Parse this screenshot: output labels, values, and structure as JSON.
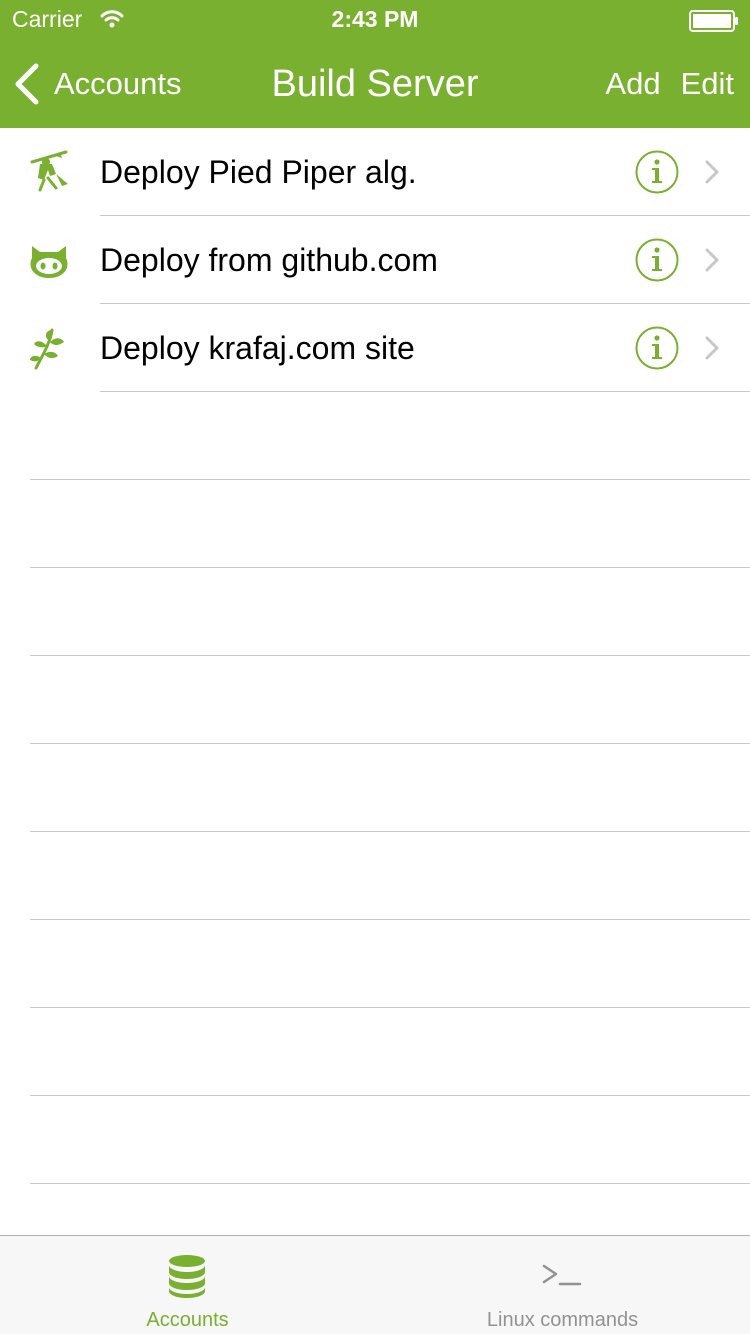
{
  "status_bar": {
    "carrier": "Carrier",
    "time": "2:43 PM",
    "icons": [
      "wifi-icon",
      "battery-icon"
    ]
  },
  "nav": {
    "back_label": "Accounts",
    "title": "Build Server",
    "add_label": "Add",
    "edit_label": "Edit"
  },
  "rows": [
    {
      "title": "Deploy Pied Piper alg.",
      "icon": "pied-piper-icon"
    },
    {
      "title": "Deploy from github.com",
      "icon": "github-octocat-icon"
    },
    {
      "title": "Deploy krafaj.com site",
      "icon": "leaf-branch-icon"
    }
  ],
  "row_accessories": {
    "info_icon": "info-circle-icon",
    "disclosure_icon": "chevron-right-icon"
  },
  "tabs": [
    {
      "label": "Accounts",
      "icon": "database-icon",
      "selected": true
    },
    {
      "label": "Linux commands",
      "icon": "terminal-icon",
      "selected": false
    }
  ],
  "colors": {
    "accent": "#79b02f",
    "tab_inactive": "#929292",
    "separator": "#c8c7cc",
    "chevron": "#c7c7cc"
  }
}
